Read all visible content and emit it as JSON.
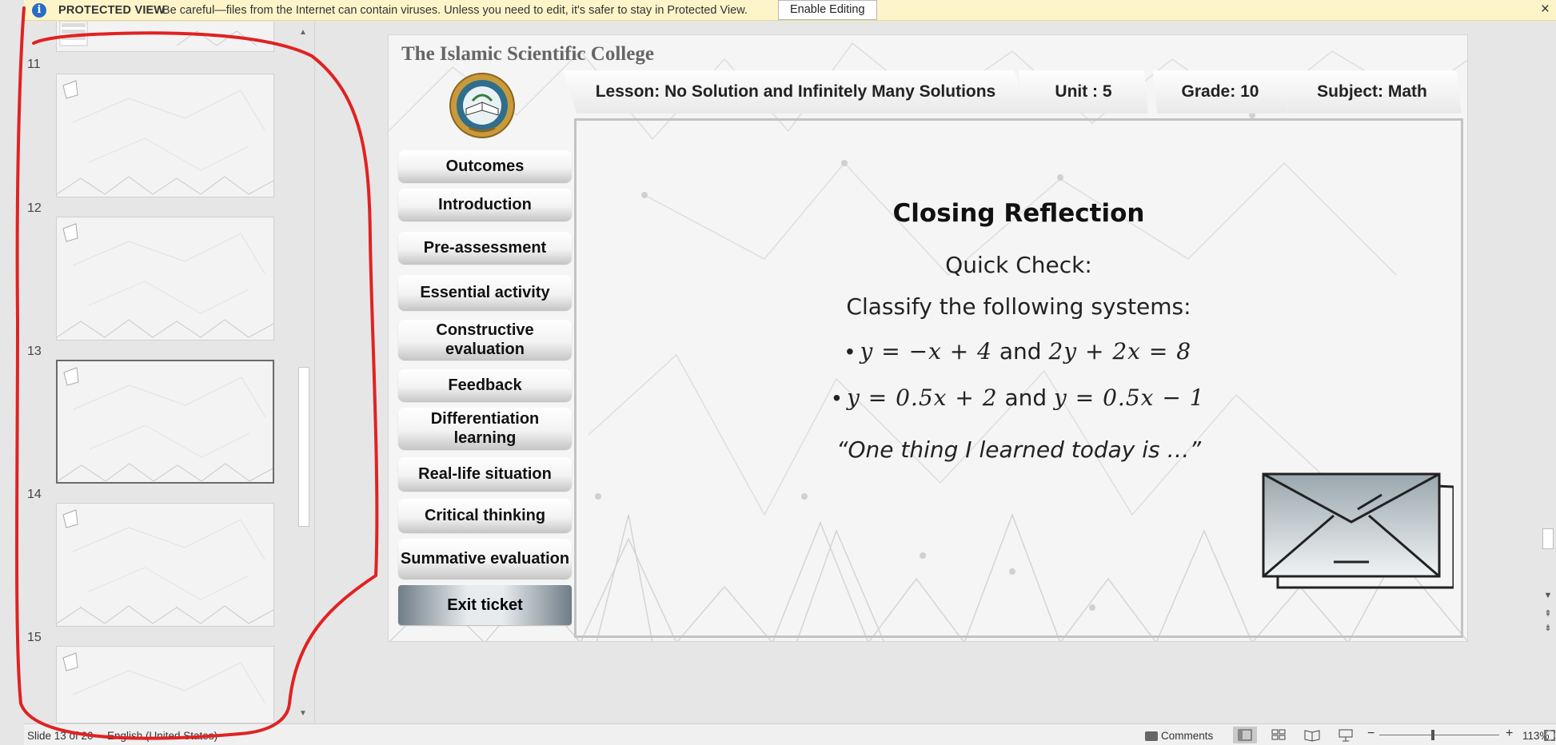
{
  "protected_view": {
    "title": "PROTECTED VIEW",
    "message": "Be careful—files from the Internet can contain viruses. Unless you need to edit, it's safer to stay in Protected View.",
    "enable_button": "Enable Editing",
    "close": "×"
  },
  "thumbnails": {
    "slides": [
      {
        "number": "11",
        "selected": false
      },
      {
        "number": "12",
        "selected": false
      },
      {
        "number": "13",
        "selected": true
      },
      {
        "number": "14",
        "selected": false
      },
      {
        "number": "15",
        "selected": false
      }
    ]
  },
  "slide": {
    "college": "The Islamic Scientific College",
    "header": {
      "lesson": "Lesson: No Solution and Infinitely Many Solutions",
      "unit": "Unit  : 5",
      "grade": "Grade: 10",
      "subject": "Subject: Math"
    },
    "menu": [
      "Outcomes",
      "Introduction",
      "Pre-assessment",
      "Essential activity",
      "Constructive evaluation",
      "Feedback",
      "Differentiation learning",
      "Real-life situation",
      "Critical thinking",
      "Summative evaluation",
      "Exit ticket"
    ],
    "content": {
      "title": "Closing Reflection",
      "quick_check": "Quick Check:",
      "classify": "Classify the following systems:",
      "bullet": "•",
      "eq1_a": "y = −x + 4",
      "eq1_and": " and ",
      "eq1_b": "2y + 2x = 8",
      "eq2_a": "y = 0.5x + 2",
      "eq2_and": " and ",
      "eq2_b": "y = 0.5x − 1",
      "quote": "“One thing I learned today is …”"
    }
  },
  "status": {
    "slide_info": "Slide 13 of 20",
    "language": "English (United States)",
    "comments": "Comments",
    "zoom": "113%"
  }
}
